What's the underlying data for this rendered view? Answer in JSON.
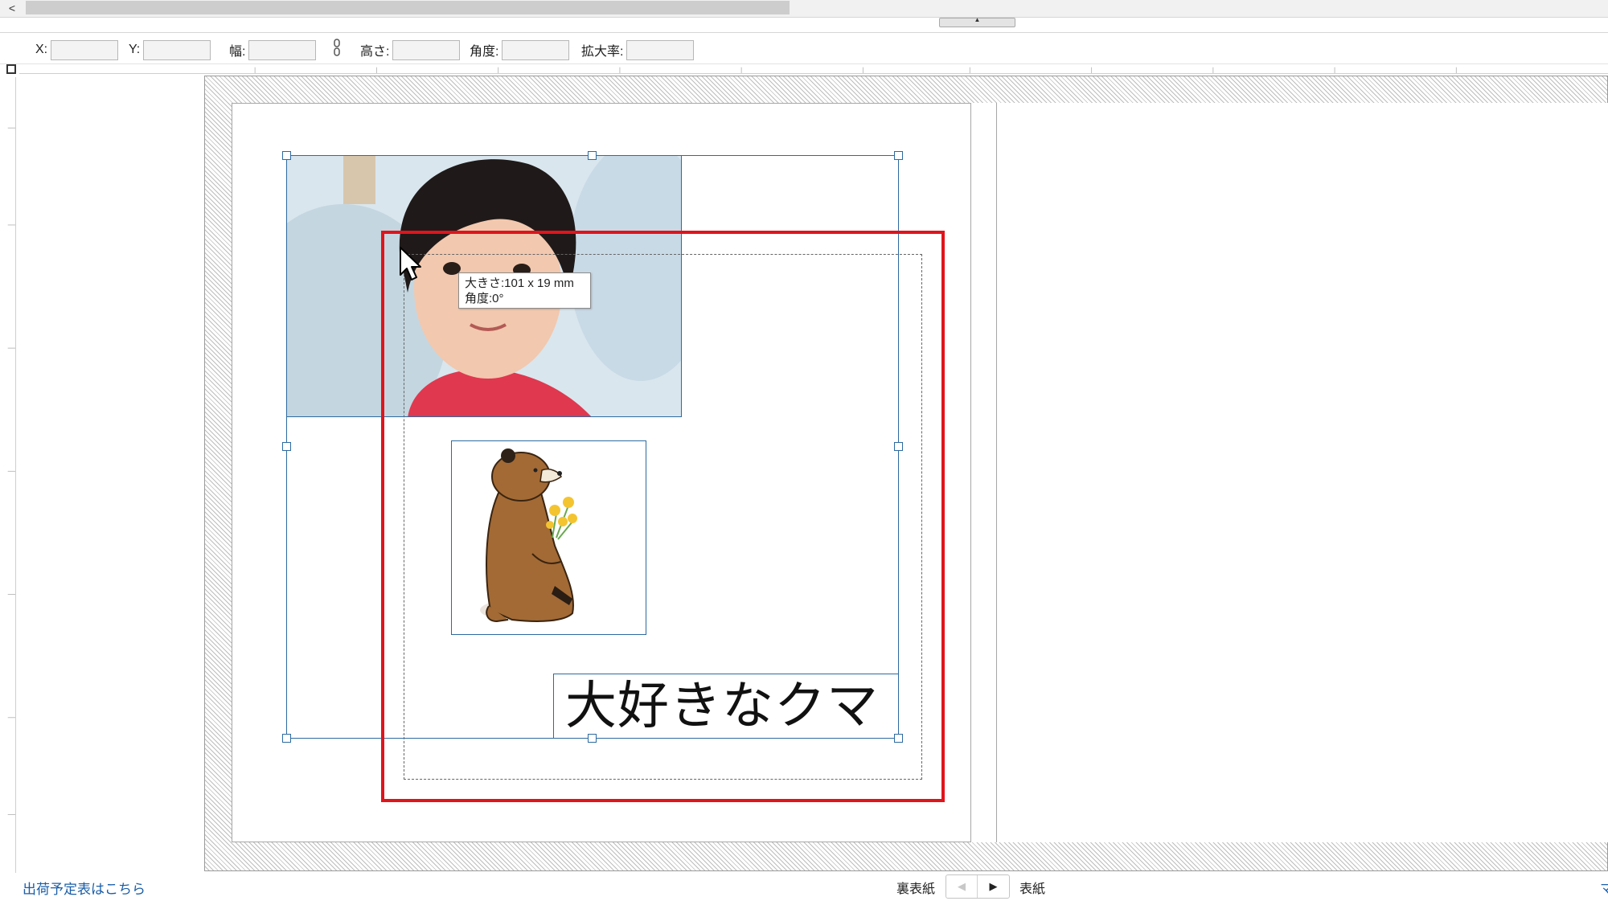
{
  "toolbar": {
    "x_label": "X:",
    "y_label": "Y:",
    "width_label": "幅:",
    "height_label": "高さ:",
    "angle_label": "角度:",
    "scale_label": "拡大率:",
    "x_value": "",
    "y_value": "",
    "width_value": "",
    "height_value": "",
    "angle_value": "",
    "scale_value": ""
  },
  "canvas": {
    "title_text": "大好きなクマ"
  },
  "tooltip": {
    "size_line": "大きさ:101 x 19 mm",
    "angle_line": "角度:0°"
  },
  "status": {
    "shipping_link": "出荷予定表はこちら",
    "back_cover_label": "裏表紙",
    "front_cover_label": "表紙",
    "right_corner_text": "マ"
  },
  "colors": {
    "selection": "#2d6aa0",
    "highlight": "#e0141b",
    "link": "#1a5ea8"
  }
}
